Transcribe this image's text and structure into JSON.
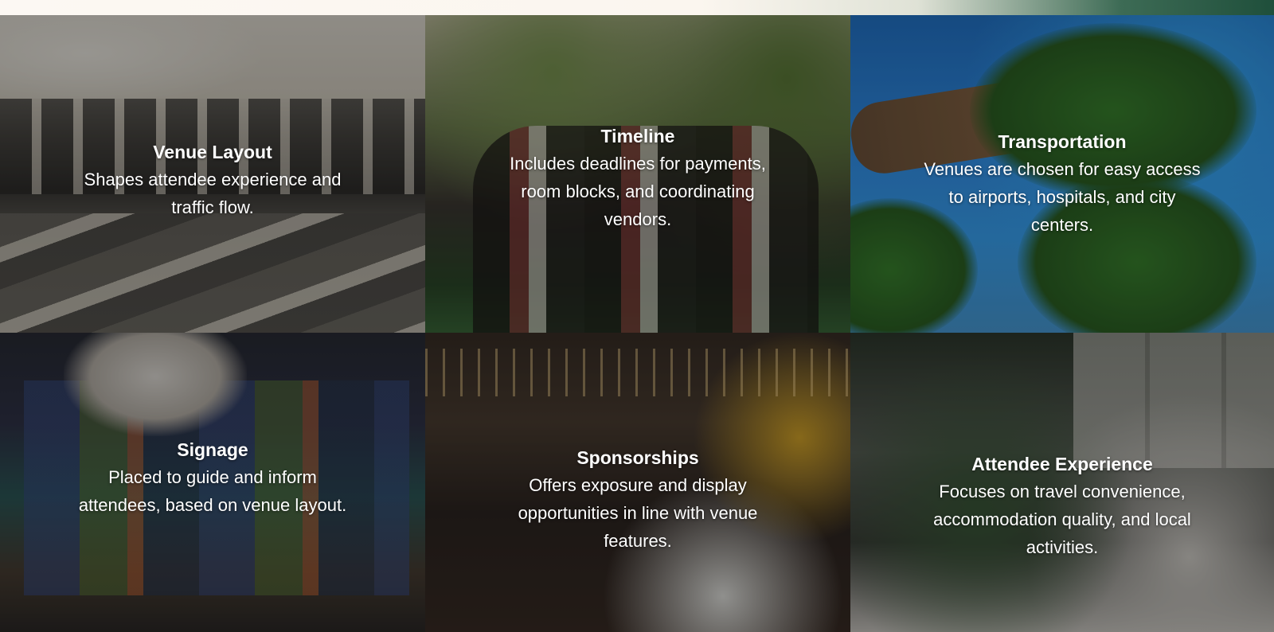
{
  "tiles": [
    {
      "title": "Venue Layout",
      "description": "Shapes attendee experience and traffic flow."
    },
    {
      "title": "Timeline",
      "description": "Includes deadlines for payments, room blocks, and coordinating vendors."
    },
    {
      "title": "Transportation",
      "description": "Venues are chosen for easy access to airports, hospitals, and city centers."
    },
    {
      "title": "Signage",
      "description": "Placed to guide and inform attendees, based on venue layout."
    },
    {
      "title": "Sponsorships",
      "description": "Offers exposure and display opportunities in line with venue features."
    },
    {
      "title": "Attendee Experience",
      "description": "Focuses on travel convenience, accommodation quality, and local activities."
    }
  ],
  "colors": {
    "caption_text": "#ffffff",
    "overlay": "#000000"
  }
}
